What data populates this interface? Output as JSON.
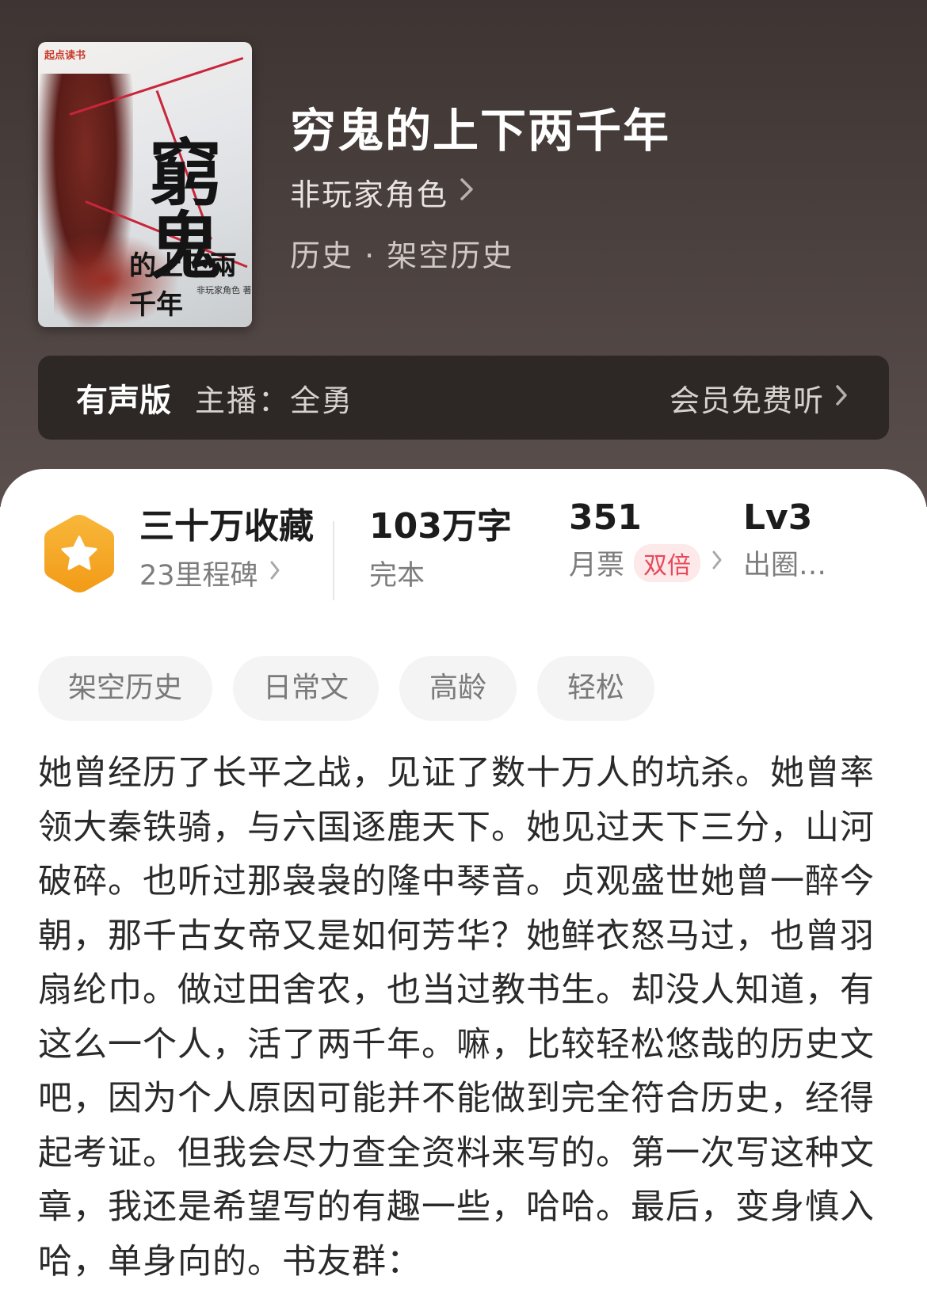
{
  "book": {
    "cover": {
      "brand": "起点读书",
      "calligraphy_main": "窮鬼",
      "calligraphy_sub": "的上下兩千年",
      "author_seal": "非玩家角色 著"
    },
    "title": "穷鬼的上下两千年",
    "author": "非玩家角色",
    "category": "历史 · 架空历史"
  },
  "audio": {
    "label": "有声版",
    "host": "主播：全勇",
    "free_listen": "会员免费听"
  },
  "stats": {
    "collections": "三十万收藏",
    "milestones": "23里程碑",
    "word_count": "103万字",
    "status": "完本",
    "monthly_tickets": "351",
    "monthly_tickets_label": "月票",
    "double_badge": "双倍",
    "level": "Lv3",
    "level_label": "出圈…"
  },
  "tags": [
    "架空历史",
    "日常文",
    "高龄",
    "轻松"
  ],
  "description": "她曾经历了长平之战，见证了数十万人的坑杀。她曾率领大秦铁骑，与六国逐鹿天下。她见过天下三分，山河破碎。也听过那袅袅的隆中琴音。贞观盛世她曾一醉今朝，那千古女帝又是如何芳华？她鲜衣怒马过，也曾羽扇纶巾。做过田舍农，也当过教书生。却没人知道，有这么一个人，活了两千年。嘛，比较轻松悠哉的历史文吧，因为个人原因可能并不能做到完全符合历史，经得起考证。但我会尽力查全资料来写的。第一次写这种文章，我还是希望写的有趣一些，哈哈。最后，变身慎入哈，单身向的。书友群：",
  "icons": {
    "chevron": "chevron-right-icon",
    "badge": "star-hexagon-badge-icon"
  },
  "colors": {
    "header_bg": "#4a403e",
    "audio_bar_bg": "#2d2726",
    "badge_orange": "#f5a623",
    "double_pill_text": "#e64a5a",
    "double_pill_bg": "#fde8ea"
  }
}
